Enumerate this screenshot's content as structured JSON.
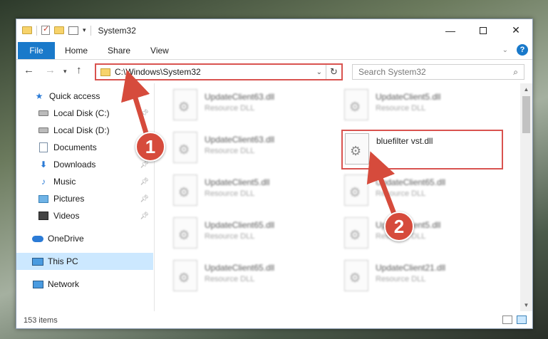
{
  "window": {
    "title": "System32"
  },
  "ribbon": {
    "tabs": [
      "File",
      "Home",
      "Share",
      "View"
    ]
  },
  "nav": {
    "address": "C:\\Windows\\System32",
    "search_placeholder": "Search System32"
  },
  "sidebar": {
    "items": [
      {
        "label": "Quick access",
        "icon": "star-icon",
        "pinned": false
      },
      {
        "label": "Local Disk (C:)",
        "icon": "disk-icon",
        "pinned": true
      },
      {
        "label": "Local Disk (D:)",
        "icon": "disk-icon",
        "pinned": false
      },
      {
        "label": "Documents",
        "icon": "documents-icon",
        "pinned": true
      },
      {
        "label": "Downloads",
        "icon": "download-icon",
        "pinned": true
      },
      {
        "label": "Music",
        "icon": "music-icon",
        "pinned": true
      },
      {
        "label": "Pictures",
        "icon": "pictures-icon",
        "pinned": true
      },
      {
        "label": "Videos",
        "icon": "videos-icon",
        "pinned": true
      },
      {
        "label": "OneDrive",
        "icon": "cloud-icon",
        "pinned": false
      },
      {
        "label": "This PC",
        "icon": "pc-icon",
        "pinned": false,
        "selected": true
      },
      {
        "label": "Network",
        "icon": "network-icon",
        "pinned": false
      }
    ]
  },
  "files": [
    {
      "name": "UpdateClient63.dll",
      "type": "Resource DLL"
    },
    {
      "name": "UpdateClient5.dll",
      "type": "Resource DLL"
    },
    {
      "name": "UpdateClient63.dll",
      "type": "Resource DLL"
    },
    {
      "name": "bluefilter vst.dll",
      "type": ""
    },
    {
      "name": "UpdateClient5.dll",
      "type": "Resource DLL"
    },
    {
      "name": "UpdateClient65.dll",
      "type": "Resource DLL"
    },
    {
      "name": "UpdateClient65.dll",
      "type": "Resource DLL"
    },
    {
      "name": "UpdateClient5.dll",
      "type": "Resource DLL"
    },
    {
      "name": "UpdateClient65.dll",
      "type": "Resource DLL"
    },
    {
      "name": "UpdateClient21.dll",
      "type": "Resource DLL"
    }
  ],
  "status": {
    "count": "153 items"
  },
  "annotations": {
    "step1": "1",
    "step2": "2"
  },
  "colors": {
    "accent": "#1979ca",
    "highlight": "#d9534f",
    "selected": "#cce8ff"
  }
}
